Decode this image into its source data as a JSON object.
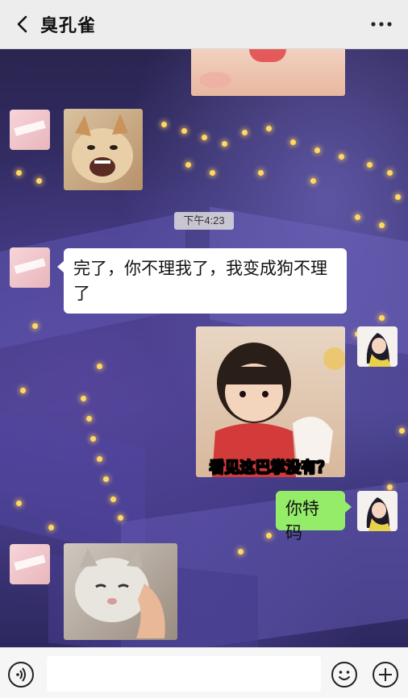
{
  "header": {
    "title": "臭孔雀",
    "back_icon": "chevron-left-icon",
    "more_icon": "more-dots-icon"
  },
  "messages": [
    {
      "side": "right",
      "type": "image",
      "content": "baby-face-sticker"
    },
    {
      "side": "left",
      "type": "image",
      "content": "barking-shiba-sticker"
    },
    {
      "side": "center",
      "type": "timestamp",
      "text": "下午4:23"
    },
    {
      "side": "left",
      "type": "text",
      "text": "完了，你不理我了，我变成狗不理了"
    },
    {
      "side": "right",
      "type": "image",
      "content": "toddler-meme",
      "caption": "看见这巴掌没有？"
    },
    {
      "side": "right",
      "type": "text",
      "text": "你特码"
    },
    {
      "side": "left",
      "type": "image",
      "content": "cat-squished-face-sticker"
    }
  ],
  "bottom": {
    "voice_icon": "voice-icon",
    "emoji_icon": "emoji-icon",
    "plus_icon": "plus-icon"
  },
  "colors": {
    "sent_bubble": "#95ec69",
    "received_bubble": "#ffffff",
    "header_bg": "#ededed"
  }
}
